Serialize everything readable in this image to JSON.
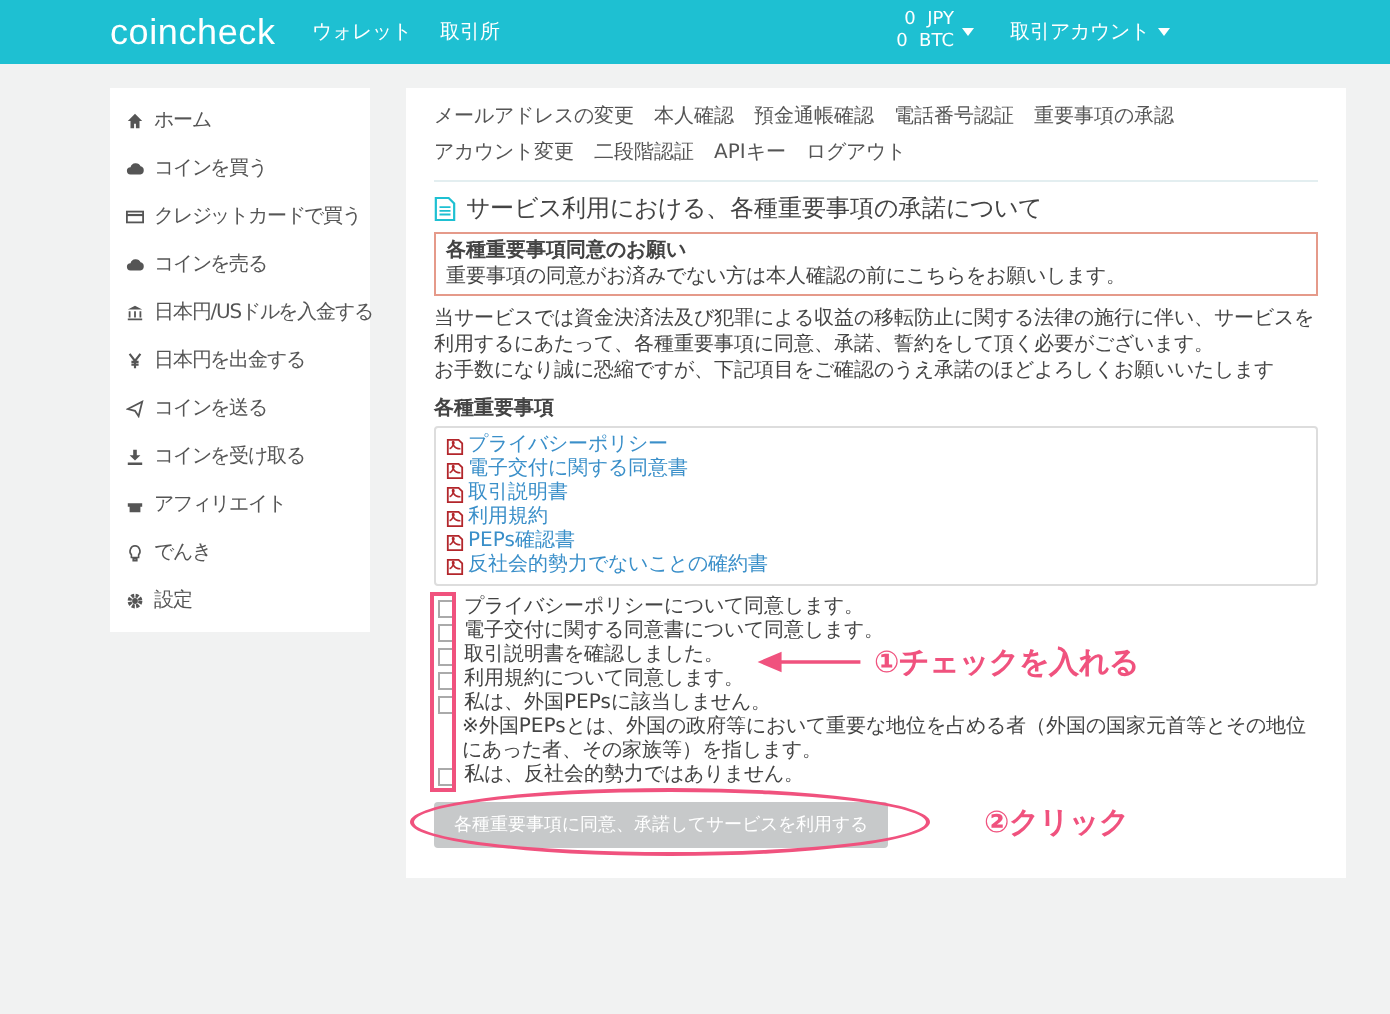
{
  "header": {
    "logo": "coincheck",
    "nav": [
      "ウォレット",
      "取引所"
    ],
    "balances": [
      {
        "amount": "0",
        "unit": "JPY"
      },
      {
        "amount": "0",
        "unit": "BTC"
      }
    ],
    "account": "取引アカウント"
  },
  "sidebar": {
    "items": [
      "ホーム",
      "コインを買う",
      "クレジットカードで買う",
      "コインを売る",
      "日本円/USドルを入金する",
      "日本円を出金する",
      "コインを送る",
      "コインを受け取る",
      "アフィリエイト",
      "でんき",
      "設定"
    ]
  },
  "tabs": [
    "メールアドレスの変更",
    "本人確認",
    "預金通帳確認",
    "電話番号認証",
    "重要事項の承認",
    "アカウント変更",
    "二段階認証",
    "APIキー",
    "ログアウト"
  ],
  "title": "サービス利用における、各種重要事項の承諾について",
  "notice": {
    "heading": "各種重要事項同意のお願い",
    "body": "重要事項の同意がお済みでない方は本人確認の前にこちらをお願いします。"
  },
  "paragraphs": [
    "当サービスでは資金決済法及び犯罪による収益の移転防止に関する法律の施行に伴い、サービスを利用するにあたって、各種重要事項に同意、承諾、誓約をして頂く必要がございます。",
    "お手数になり誠に恐縮ですが、下記項目をご確認のうえ承諾のほどよろしくお願いいたします"
  ],
  "documents": {
    "heading": "各種重要事項",
    "items": [
      "プライバシーポリシー",
      "電子交付に関する同意書",
      "取引説明書",
      "利用規約",
      "PEPs確認書",
      "反社会的勢力でないことの確約書"
    ]
  },
  "checks": [
    {
      "label": "プライバシーポリシーについて同意します。",
      "checked": false
    },
    {
      "label": "電子交付に関する同意書について同意します。",
      "checked": false
    },
    {
      "label": "取引説明書を確認しました。",
      "checked": false
    },
    {
      "label": "利用規約について同意します。",
      "checked": false
    },
    {
      "label": "私は、外国PEPsに該当しません。",
      "checked": false,
      "note": "※外国PEPsとは、外国の政府等において重要な地位を占める者（外国の国家元首等とその地位にあった者、その家族等）を指します。"
    },
    {
      "label": "私は、反社会的勢力ではありません。",
      "checked": false
    }
  ],
  "submit": {
    "label": "各種重要事項に同意、承諾してサービスを利用する",
    "disabled": true
  },
  "annotations": [
    "①チェックを入れる",
    "②クリック"
  ]
}
